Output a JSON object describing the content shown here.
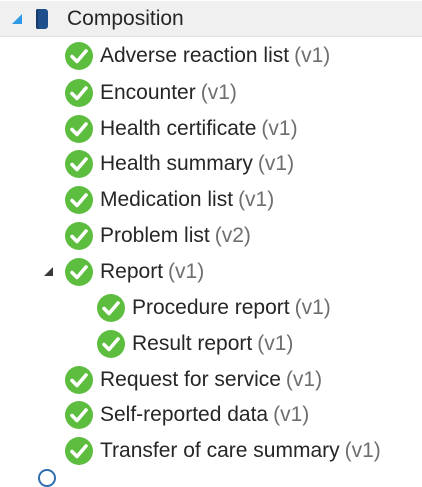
{
  "root": {
    "label": "Composition"
  },
  "items": [
    {
      "name": "Adverse reaction list",
      "version": "(v1)"
    },
    {
      "name": "Encounter",
      "version": "(v1)"
    },
    {
      "name": "Health certificate",
      "version": "(v1)"
    },
    {
      "name": "Health summary",
      "version": "(v1)"
    },
    {
      "name": "Medication list",
      "version": "(v1)"
    },
    {
      "name": "Problem list",
      "version": "(v2)"
    },
    {
      "name": "Report",
      "version": "(v1)"
    },
    {
      "name": "Procedure report",
      "version": "(v1)"
    },
    {
      "name": "Result report",
      "version": "(v1)"
    },
    {
      "name": "Request for service",
      "version": "(v1)"
    },
    {
      "name": "Self-reported data",
      "version": "(v1)"
    },
    {
      "name": "Transfer of care summary",
      "version": "(v1)"
    }
  ],
  "colors": {
    "check_green": "#5cbd3e",
    "selection_background": "#f0f0f0",
    "expander_blue": "#2f9ae6",
    "book_blue": "#1f4e8c"
  },
  "icons": {
    "root": "book-icon",
    "item": "check-circle-icon",
    "expanded": "expanded-triangle-icon"
  }
}
